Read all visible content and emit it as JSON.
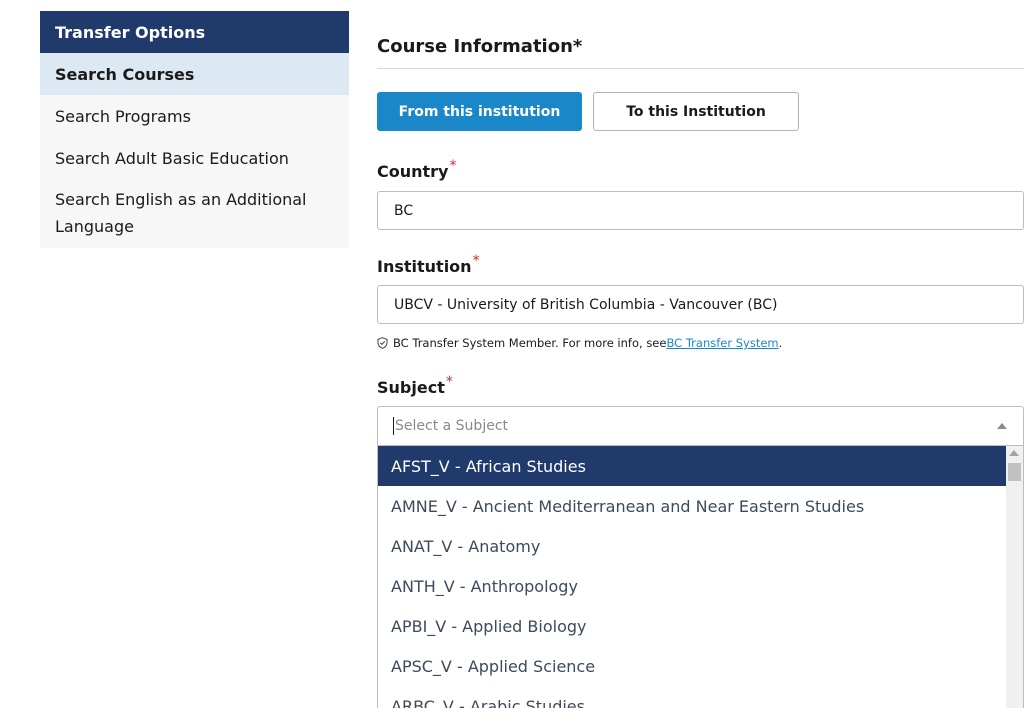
{
  "sidebar": {
    "header": "Transfer Options",
    "items": [
      {
        "label": "Search Courses"
      },
      {
        "label": "Search Programs"
      },
      {
        "label": "Search Adult Basic Education"
      },
      {
        "label": "Search English as an Additional Language"
      }
    ]
  },
  "main": {
    "section_title": "Course Information*",
    "from_button": "From this institution",
    "to_button": "To this Institution",
    "country": {
      "label": "Country",
      "required_mark": "*",
      "value": "BC"
    },
    "institution": {
      "label": "Institution",
      "required_mark": "*",
      "value": "UBCV - University of British Columbia - Vancouver (BC)"
    },
    "info": {
      "text": "BC Transfer System Member. For more info, see ",
      "link": "BC Transfer System",
      "suffix": "."
    },
    "subject": {
      "label": "Subject",
      "required_mark": "*",
      "placeholder": "Select a Subject",
      "options": [
        "AFST_V - African Studies",
        "AMNE_V - Ancient Mediterranean and Near Eastern Studies",
        "ANAT_V - Anatomy",
        "ANTH_V - Anthropology",
        "APBI_V - Applied Biology",
        "APSC_V - Applied Science",
        "ARBC_V - Arabic Studies"
      ]
    }
  },
  "colors": {
    "brand": "#1f3a6b",
    "accent": "#1a87c9",
    "required": "#d0262d"
  }
}
